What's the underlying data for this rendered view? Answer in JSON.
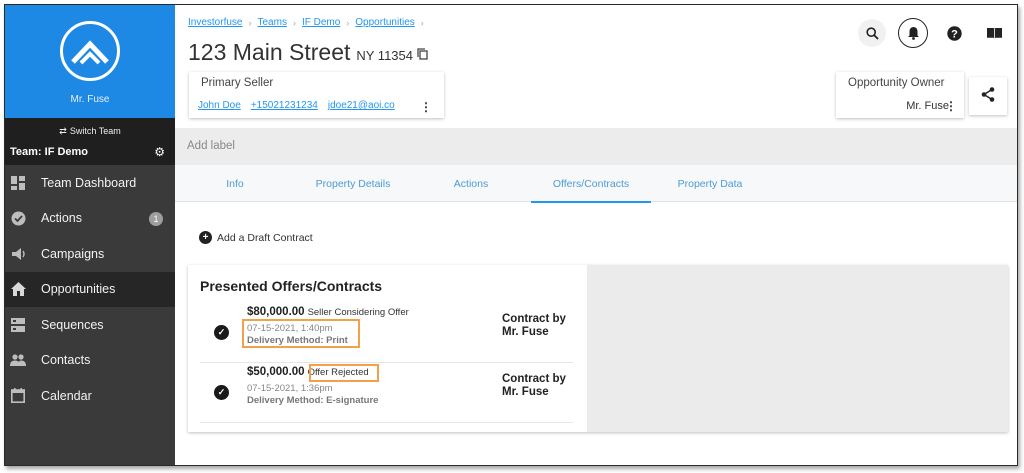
{
  "sidebar": {
    "user_name": "Mr. Fuse",
    "switch_team": "Switch Team",
    "team_name": "Team: IF Demo",
    "items": [
      {
        "label": "Team Dashboard",
        "icon": "dashboard-icon"
      },
      {
        "label": "Actions",
        "icon": "check-circle-icon",
        "badge": "1"
      },
      {
        "label": "Campaigns",
        "icon": "megaphone-icon"
      },
      {
        "label": "Opportunities",
        "icon": "home-icon",
        "active": true
      },
      {
        "label": "Sequences",
        "icon": "sequences-icon"
      },
      {
        "label": "Contacts",
        "icon": "people-icon"
      },
      {
        "label": "Calendar",
        "icon": "calendar-icon"
      }
    ]
  },
  "breadcrumb": [
    "Investorfuse",
    "Teams",
    "IF Demo",
    "Opportunities"
  ],
  "property": {
    "address": "123 Main Street",
    "state_zip": "NY 11354"
  },
  "primary_seller": {
    "label": "Primary Seller",
    "name": "John Doe",
    "phone": "+15021231234",
    "email": "jdoe21@aoi.co"
  },
  "owner": {
    "label": "Opportunity Owner",
    "name": "Mr. Fuse"
  },
  "label_bar": {
    "placeholder": "Add label"
  },
  "tabs": [
    "Info",
    "Property Details",
    "Actions",
    "Offers/Contracts",
    "Property Data"
  ],
  "active_tab": "Offers/Contracts",
  "add_draft": "Add a Draft Contract",
  "offers": {
    "title": "Presented Offers/Contracts",
    "rows": [
      {
        "amount": "$80,000.00",
        "status": "Seller Considering Offer",
        "date": "07-15-2021, 1:40pm",
        "method": "Delivery Method: Print",
        "contract_by": "Contract by Mr. Fuse"
      },
      {
        "amount": "$50,000.00",
        "status": "Offer Rejected",
        "date": "07-15-2021, 1:36pm",
        "method": "Delivery Method: E-signature",
        "contract_by": "Contract by Mr. Fuse"
      }
    ]
  },
  "colors": {
    "brand_blue": "#1e88e5",
    "link_blue": "#2196f3",
    "highlight_orange": "#f0a14a",
    "sidebar_bg": "#3a3a3a"
  }
}
